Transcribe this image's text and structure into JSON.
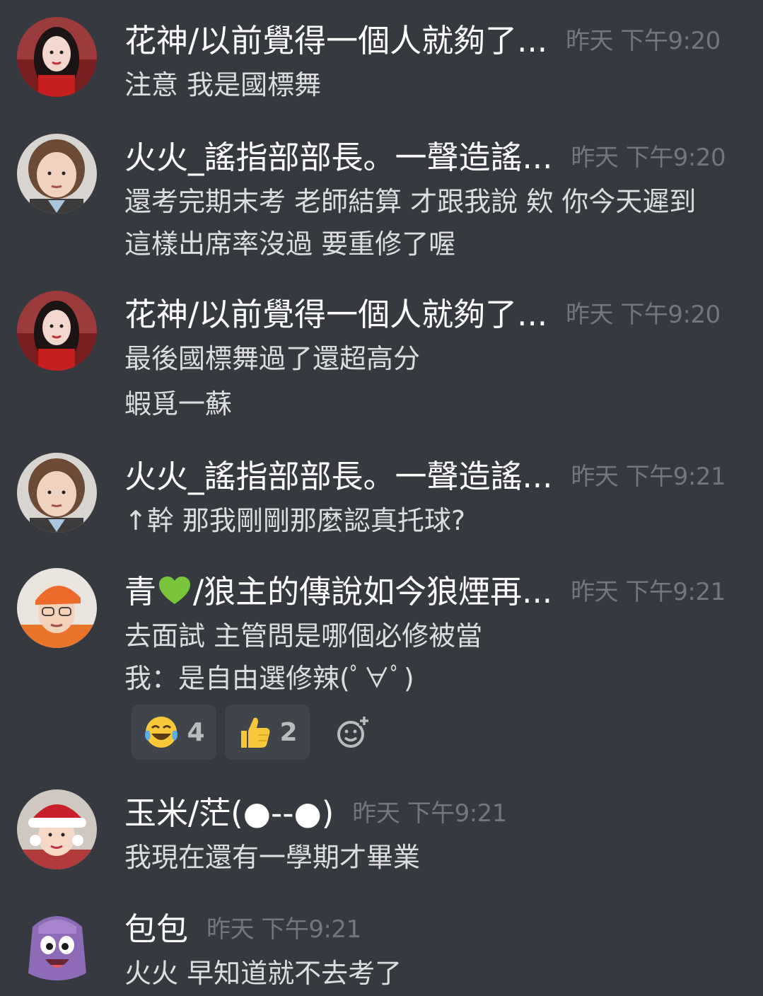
{
  "messages": [
    {
      "author": "花神/以前覺得一個人就夠了...",
      "time": "昨天 下午9:20",
      "avatar": "avatar-girl-dark-hair",
      "lines": [
        "注意  我是國標舞"
      ]
    },
    {
      "author": "火火_謠指部部長。一聲造謠...",
      "time": "昨天 下午9:20",
      "avatar": "avatar-girl-short-hair",
      "lines": [
        "還考完期末考 老師結算 才跟我說 欸 你今天遲到",
        "這樣出席率沒過 要重修了喔"
      ]
    },
    {
      "author": "花神/以前覺得一個人就夠了...",
      "time": "昨天 下午9:20",
      "avatar": "avatar-girl-dark-hair",
      "lines": [
        "最後國標舞過了還超高分",
        "蝦覓一蘇"
      ]
    },
    {
      "author": "火火_謠指部部長。一聲造謠...",
      "time": "昨天 下午9:21",
      "avatar": "avatar-girl-short-hair",
      "lines": [
        "↑幹 那我剛剛那麼認真托球?"
      ]
    },
    {
      "author_prefix": "青",
      "author_suffix": "/狼主的傳說如今狼煙再...",
      "author_icon": "green-heart-icon",
      "time": "昨天 下午9:21",
      "avatar": "avatar-boy-orange-cap",
      "lines": [
        "去面試 主管問是哪個必修被當",
        "我：是自由選修辣(ﾟ∀ﾟ)"
      ],
      "reactions": [
        {
          "emoji": "tears-of-joy-icon",
          "count": "4"
        },
        {
          "emoji": "thumbs-up-icon",
          "count": "2"
        }
      ],
      "add_reaction_icon": "add-reaction-icon"
    },
    {
      "author": "玉米/茫(●--●)",
      "time": "昨天 下午9:21",
      "avatar": "avatar-girl-santa-hat",
      "lines": [
        "我現在還有一學期才畢業"
      ]
    },
    {
      "author": "包包",
      "time": "昨天 下午9:21",
      "avatar": "avatar-purple-backpack",
      "lines": [
        "火火 早知道就不去考了"
      ]
    }
  ],
  "colors": {
    "background": "#36393f",
    "name": "#ffffff",
    "text": "#dcddde",
    "timestamp": "#72767d",
    "reaction_bg": "#40444b"
  }
}
